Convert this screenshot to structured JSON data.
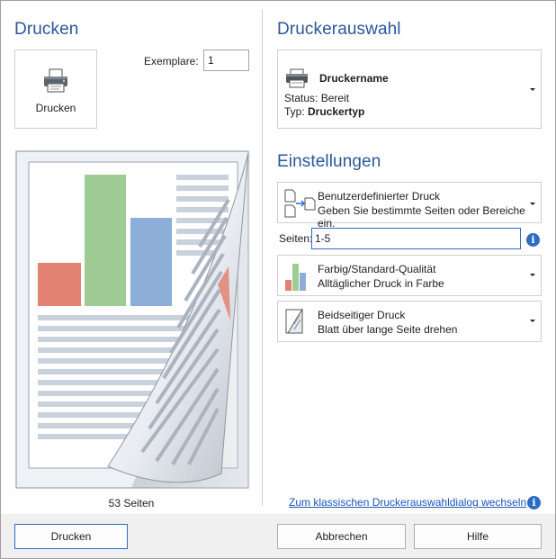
{
  "left": {
    "title": "Drucken",
    "print_button_label": "Drucken",
    "copies_label": "Exemplare:",
    "copies_value": "1",
    "page_count": "53 Seiten"
  },
  "right": {
    "title_printer": "Druckerauswahl",
    "printer": {
      "name": "Druckername",
      "status": "Status: Bereit",
      "type_prefix": "Typ: ",
      "type_value": "Druckertyp"
    },
    "title_settings": "Einstellungen",
    "range": {
      "title": "Benutzerdefinierter Druck",
      "subtitle": "Geben Sie bestimmte Seiten oder Bereiche ein."
    },
    "pages_label": "Seiten:",
    "pages_value": "1-5",
    "color": {
      "title": "Farbig/Standard-Qualität",
      "subtitle": "Alltäglicher Druck in Farbe"
    },
    "duplex": {
      "title": "Beidseitiger Druck",
      "subtitle": "Blatt über lange Seite drehen"
    },
    "classic_link": "Zum klassischen Druckerauswahldialog wechseln"
  },
  "footer": {
    "print_label": "Drucken",
    "cancel_label": "Abbrechen",
    "help_label": "Hilfe"
  },
  "icons": {
    "info": "info-icon",
    "printer": "printer-icon",
    "page_range": "page-range-icon",
    "color_quality": "bar-chart-icon",
    "duplex": "duplex-page-icon"
  },
  "colors": {
    "heading": "#2b5797",
    "accent": "#2b6cc4",
    "link": "#1a56b8"
  }
}
